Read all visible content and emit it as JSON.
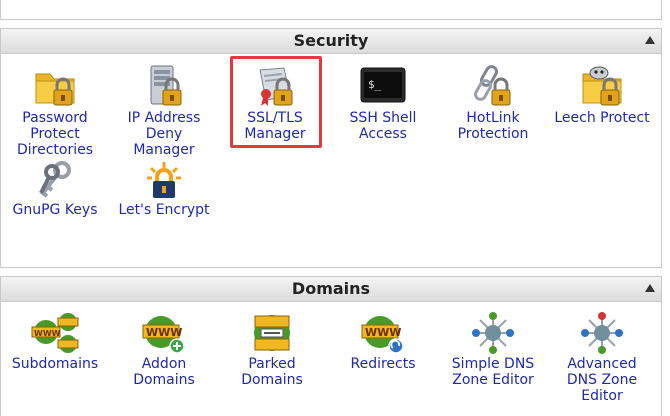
{
  "security": {
    "title": "Security",
    "items": [
      {
        "label": "Password Protect Directories",
        "icon": "folder-lock-icon"
      },
      {
        "label": "IP Address Deny Manager",
        "icon": "server-lock-icon"
      },
      {
        "label": "SSL/TLS Manager",
        "icon": "certificate-lock-icon"
      },
      {
        "label": "SSH Shell Access",
        "icon": "terminal-icon"
      },
      {
        "label": "HotLink Protection",
        "icon": "chain-lock-icon"
      },
      {
        "label": "Leech Protect",
        "icon": "folder-leech-lock-icon"
      },
      {
        "label": "GnuPG Keys",
        "icon": "keys-icon"
      },
      {
        "label": "Let's Encrypt",
        "icon": "lets-encrypt-lock-icon"
      }
    ]
  },
  "domains": {
    "title": "Domains",
    "items": [
      {
        "label": "Subdomains",
        "icon": "www-globes-icon"
      },
      {
        "label": "Addon Domains",
        "icon": "www-add-icon"
      },
      {
        "label": "Parked Domains",
        "icon": "www-parked-icon"
      },
      {
        "label": "Redirects",
        "icon": "www-redirect-icon"
      },
      {
        "label": "Simple DNS Zone Editor",
        "icon": "dns-network-icon"
      },
      {
        "label": "Advanced DNS Zone Editor",
        "icon": "dns-network-advanced-icon"
      }
    ]
  },
  "terminal_prompt": "$_",
  "www_text": "WWW",
  "highlight_color": "#e0393e"
}
